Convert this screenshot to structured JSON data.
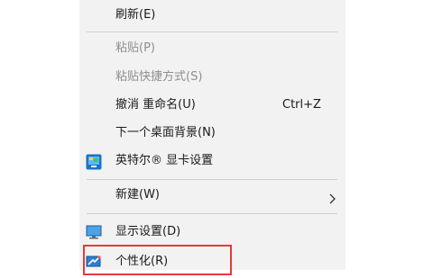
{
  "context_menu": {
    "refresh": "刷新(E)",
    "paste": "粘贴(P)",
    "paste_shortcut": "粘贴快捷方式(S)",
    "undo_rename": "撤消 重命名(U)",
    "undo_rename_shortcut": "Ctrl+Z",
    "next_background": "下一个桌面背景(N)",
    "intel_graphics": "英特尔® 显卡设置",
    "new": "新建(W)",
    "display_settings": "显示设置(D)",
    "personalize": "个性化(R)"
  },
  "icons": {
    "intel_graphics": "intel-graphics-icon",
    "display_settings": "monitor-icon",
    "personalize": "personalize-icon",
    "new_submenu": "chevron-right-icon"
  },
  "colors": {
    "menu_background": "#f2f2f2",
    "disabled_text": "#8e8e8e",
    "highlight_border": "#e43b3b",
    "icon_blue": "#1a73c9"
  }
}
